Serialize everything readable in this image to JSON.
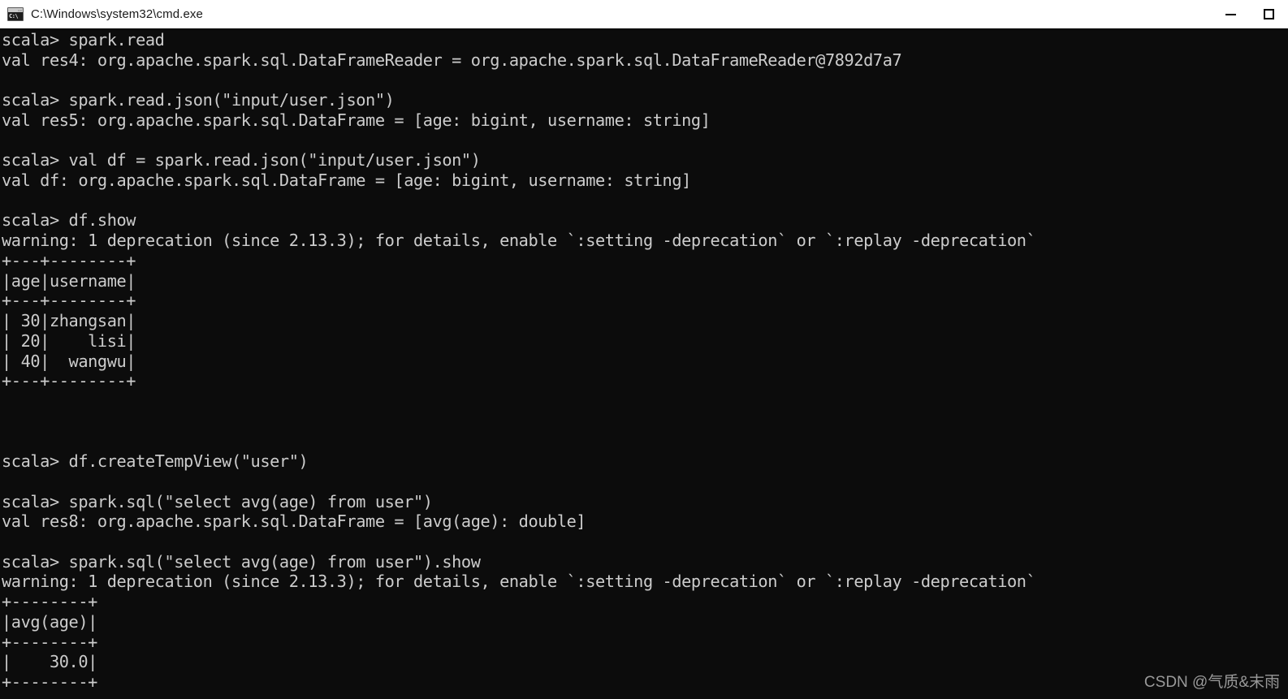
{
  "window": {
    "title": "C:\\Windows\\system32\\cmd.exe",
    "icon": "cmd-console-icon",
    "icon_prompt_text": "C:\\",
    "background_color": "#0c0c0c",
    "titlebar_color": "#ffffff",
    "text_color": "#cccccc",
    "controls": {
      "minimize_label": "─",
      "maximize_label": "□"
    }
  },
  "terminal": {
    "lines": [
      "scala> spark.read",
      "val res4: org.apache.spark.sql.DataFrameReader = org.apache.spark.sql.DataFrameReader@7892d7a7",
      "",
      "scala> spark.read.json(\"input/user.json\")",
      "val res5: org.apache.spark.sql.DataFrame = [age: bigint, username: string]",
      "",
      "scala> val df = spark.read.json(\"input/user.json\")",
      "val df: org.apache.spark.sql.DataFrame = [age: bigint, username: string]",
      "",
      "scala> df.show",
      "warning: 1 deprecation (since 2.13.3); for details, enable `:setting -deprecation` or `:replay -deprecation`",
      "+---+--------+",
      "|age|username|",
      "+---+--------+",
      "| 30|zhangsan|",
      "| 20|    lisi|",
      "| 40|  wangwu|",
      "+---+--------+",
      "",
      "",
      "",
      "scala> df.createTempView(\"user\")",
      "",
      "scala> spark.sql(\"select avg(age) from user\")",
      "val res8: org.apache.spark.sql.DataFrame = [avg(age): double]",
      "",
      "scala> spark.sql(\"select avg(age) from user\").show",
      "warning: 1 deprecation (since 2.13.3); for details, enable `:setting -deprecation` or `:replay -deprecation`",
      "+--------+",
      "|avg(age)|",
      "+--------+",
      "|    30.0|",
      "+--------+"
    ],
    "dataframe_show_table": {
      "columns": [
        "age",
        "username"
      ],
      "rows": [
        [
          "30",
          "zhangsan"
        ],
        [
          "20",
          "lisi"
        ],
        [
          "40",
          "wangwu"
        ]
      ]
    },
    "sql_avg_table": {
      "columns": [
        "avg(age)"
      ],
      "rows": [
        [
          "30.0"
        ]
      ]
    }
  },
  "watermark": {
    "text": "CSDN @气质&末雨"
  }
}
